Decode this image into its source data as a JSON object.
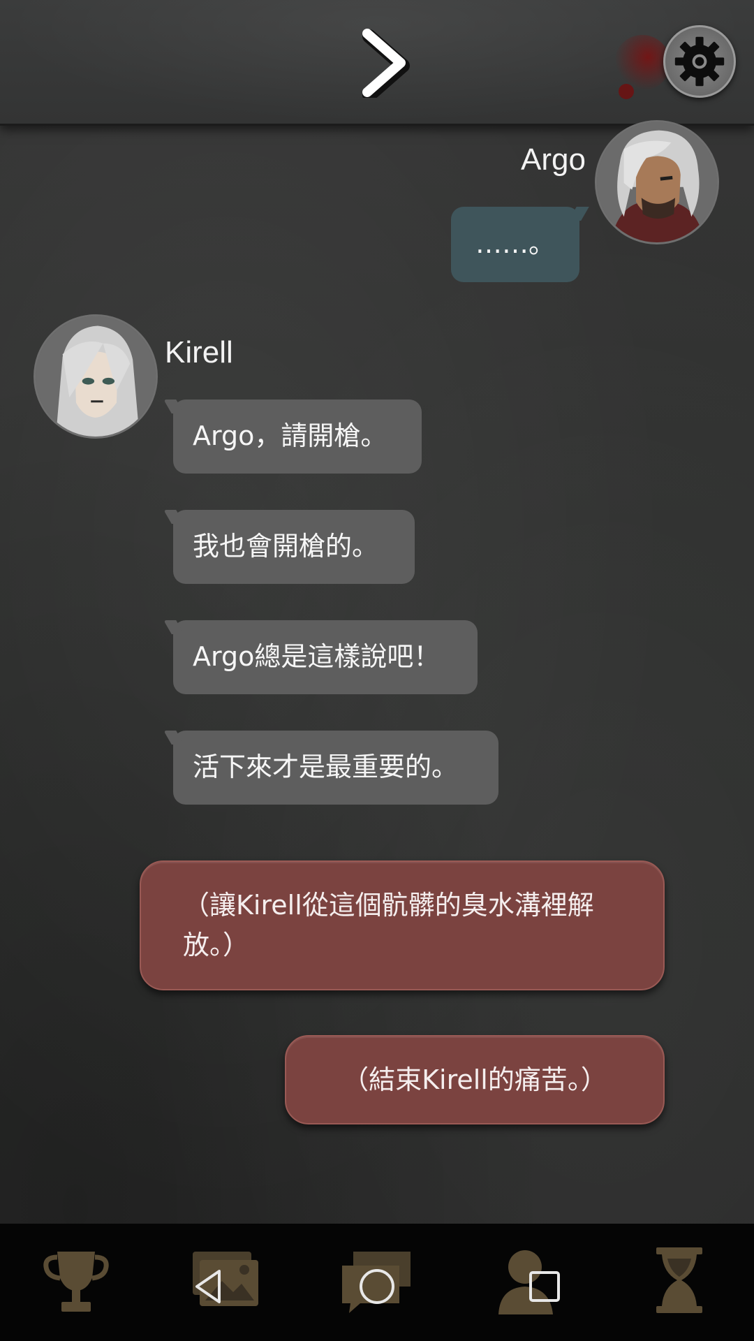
{
  "topbar": {
    "next_icon": "chevron-right-icon",
    "settings_icon": "gear-icon"
  },
  "messages": {
    "argo_name": "Argo",
    "argo_line": "……。",
    "kirell_name": "Kirell",
    "kirell_lines": [
      "Argo，請開槍。",
      "我也會開槍的。",
      "Argo總是這樣說吧！",
      "活下來才是最重要的。"
    ]
  },
  "choices": {
    "option_1": "（讓Kirell從這個骯髒的臭水溝裡解放。）",
    "option_2": "（結束Kirell的痛苦。）"
  },
  "bottom_menu": {
    "icons": [
      "trophy-icon",
      "gallery-icon",
      "chat-icon",
      "profile-icon",
      "hourglass-icon"
    ]
  },
  "system_nav": {
    "icons": [
      "back-icon",
      "home-icon",
      "recents-icon"
    ]
  },
  "colors": {
    "left_bubble": "#5e5e5e",
    "right_bubble": "#3f555b",
    "choice": "#7b4340",
    "menu_icon": "#5a4c34"
  }
}
